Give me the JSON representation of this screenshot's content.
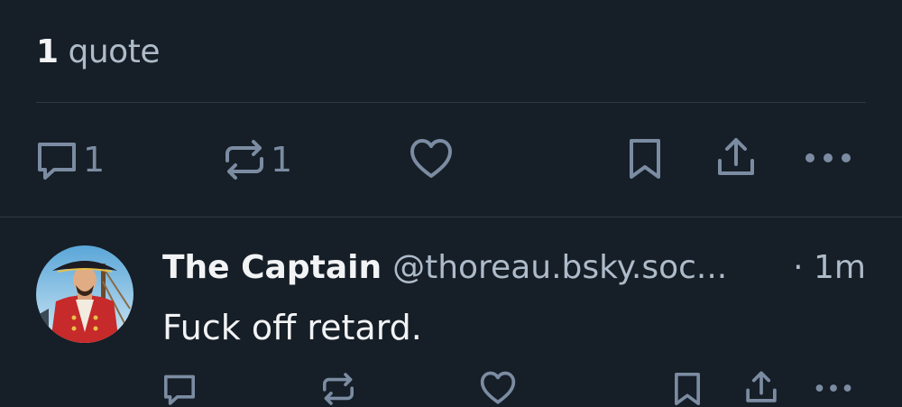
{
  "quotes": {
    "count": "1",
    "label": "quote"
  },
  "main_actions": {
    "reply_count": "1",
    "repost_count": "1"
  },
  "reply": {
    "display_name": "The Captain",
    "handle": "@thoreau.bsky.soc...",
    "time": "· 1m",
    "text": "Fuck off retard."
  },
  "icons": [
    "reply-icon",
    "repost-icon",
    "like-icon",
    "bookmark-icon",
    "share-icon",
    "more-icon"
  ],
  "colors": {
    "background": "#161e27",
    "icon": "#7b8ca2",
    "divider": "#2e3945",
    "muted_text": "#aebbc9"
  }
}
